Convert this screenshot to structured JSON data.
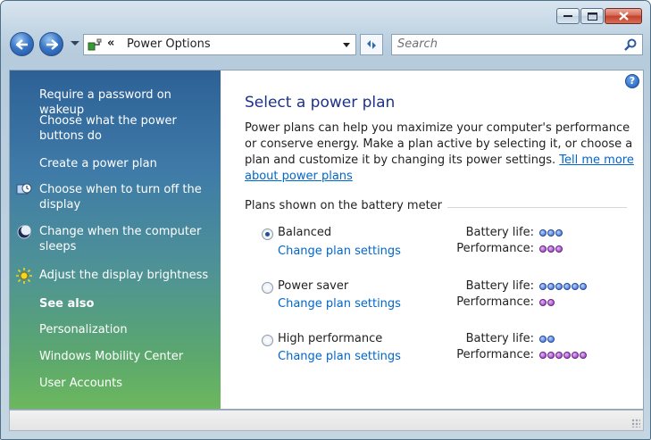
{
  "address": {
    "path_label": "Power Options"
  },
  "search": {
    "placeholder": "Search"
  },
  "sidebar": {
    "tasks": [
      {
        "label": "Require a password on wakeup"
      },
      {
        "label": "Choose what the power buttons do"
      },
      {
        "label": "Create a power plan"
      },
      {
        "label": "Choose when to turn off the display",
        "icon": "display-clock-icon"
      },
      {
        "label": "Change when the computer sleeps",
        "icon": "moon-icon"
      },
      {
        "label": "Adjust the display brightness",
        "icon": "brightness-sun-icon"
      }
    ],
    "see_also_label": "See also",
    "see_also": [
      {
        "label": "Personalization"
      },
      {
        "label": "Windows Mobility Center"
      },
      {
        "label": "User Accounts"
      }
    ]
  },
  "main": {
    "title": "Select a power plan",
    "description": "Power plans can help you maximize your computer's performance or conserve energy. Make a plan active by selecting it, or choose a plan and customize it by changing its power settings.",
    "link": "Tell me more about power plans",
    "group_label": "Plans shown on the battery meter",
    "battery_label": "Battery life:",
    "performance_label": "Performance:",
    "change_link": "Change plan settings",
    "plans": [
      {
        "name": "Balanced",
        "selected": true,
        "battery_life": 3,
        "performance": 3
      },
      {
        "name": "Power saver",
        "selected": false,
        "battery_life": 6,
        "performance": 2
      },
      {
        "name": "High performance",
        "selected": false,
        "battery_life": 2,
        "performance": 6
      }
    ]
  },
  "colors": {
    "title": "#1e3287",
    "link": "#0066cc",
    "battery_dot": "#2f63d0",
    "performance_dot": "#8c2fb8"
  }
}
